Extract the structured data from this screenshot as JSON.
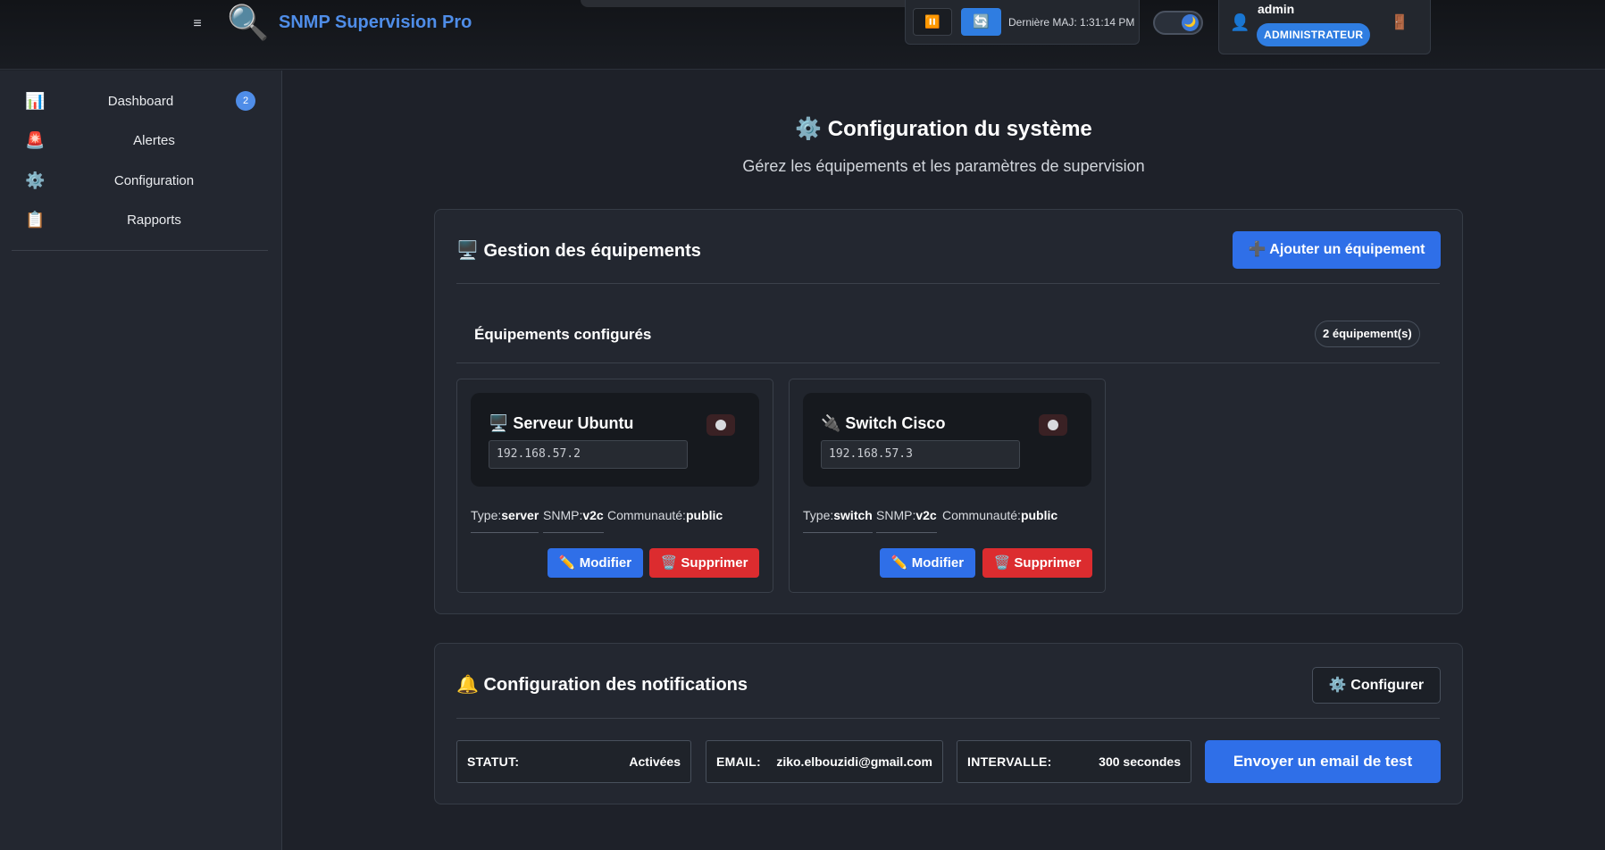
{
  "header": {
    "menu_icon": "≡",
    "logo_icon": "🔍",
    "app_title": "SNMP Supervision Pro",
    "pause_icon": "⏸️",
    "refresh_icon": "🔄",
    "last_update": "Dernière MAJ: 1:31:14 PM",
    "theme_icon": "🌙",
    "user_icon": "👤",
    "username": "admin",
    "role": "ADMINISTRATEUR",
    "logout_icon": "🚪"
  },
  "sidebar": {
    "items": [
      {
        "icon": "📊",
        "label": "Dashboard",
        "badge": "2"
      },
      {
        "icon": "🚨",
        "label": "Alertes"
      },
      {
        "icon": "⚙️",
        "label": "Configuration"
      },
      {
        "icon": "📋",
        "label": "Rapports"
      }
    ]
  },
  "page": {
    "title": "⚙️ Configuration du système",
    "subtitle": "Gérez les équipements et les paramètres de supervision"
  },
  "equipment": {
    "title": "🖥️ Gestion des équipements",
    "add_label": "➕ Ajouter un équipement",
    "configured_title": "Équipements configurés",
    "count_label": "2 équipement(s)",
    "devices": [
      {
        "name": "🖥️ Serveur Ubuntu",
        "ip": "192.168.57.2",
        "type_label": "Type:",
        "type": "server",
        "snmp_label": "SNMP:",
        "snmp": "v2c",
        "community_label": "Communauté:",
        "community": "public",
        "edit_label": "✏️ Modifier",
        "delete_label": "🗑️ Supprimer"
      },
      {
        "name": "🔌 Switch Cisco",
        "ip": "192.168.57.3",
        "type_label": "Type:",
        "type": "switch",
        "snmp_label": "SNMP:",
        "snmp": "v2c",
        "community_label": "Communauté:",
        "community": "public",
        "edit_label": "✏️ Modifier",
        "delete_label": "🗑️ Supprimer"
      }
    ]
  },
  "notifications": {
    "title": "🔔 Configuration des notifications",
    "configure_label": "⚙️ Configurer",
    "status_label": "STATUT:",
    "status_value": "Activées",
    "email_label": "EMAIL:",
    "email_value": "ziko.elbouzidi@gmail.com",
    "interval_label": "INTERVALLE:",
    "interval_value": "300 secondes",
    "test_label": "Envoyer un email de test"
  },
  "colors": {
    "accent": "#2f6fe8",
    "danger": "#dc2c2f",
    "background": "#1e2129",
    "panel": "#232730"
  }
}
